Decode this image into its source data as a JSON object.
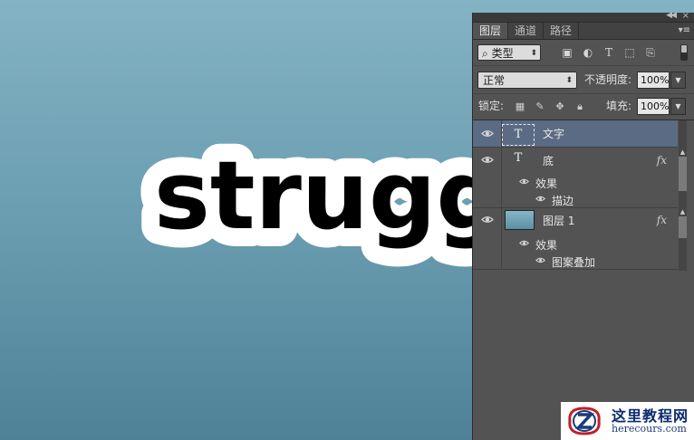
{
  "canvas": {
    "artwork_text": "struggl",
    "colors": {
      "bg_top": "#83b3c4",
      "bg_bottom": "#4f8197",
      "text": "#000000",
      "stroke": "#ffffff"
    }
  },
  "panel": {
    "tabs": [
      {
        "label": "图层",
        "active": true
      },
      {
        "label": "通道",
        "active": false
      },
      {
        "label": "路径",
        "active": false
      }
    ],
    "filter": {
      "kind_label": "类型",
      "icons": [
        "image-filter-icon",
        "adjustment-filter-icon",
        "type-filter-icon",
        "shape-filter-icon",
        "smart-object-filter-icon"
      ]
    },
    "blend": {
      "mode": "正常",
      "opacity_label": "不透明度:",
      "opacity_value": "100%"
    },
    "lock": {
      "label": "锁定:",
      "fill_label": "填充:",
      "fill_value": "100%"
    },
    "layers": [
      {
        "name": "文字",
        "type": "text",
        "selected": true,
        "visible": true
      },
      {
        "name": "底",
        "type": "text",
        "selected": false,
        "visible": true,
        "fx": "fx",
        "effects_label": "效果",
        "effects": [
          "描边"
        ]
      },
      {
        "name": "图层 1",
        "type": "image",
        "selected": false,
        "visible": true,
        "fx": "fx",
        "effects_label": "效果",
        "effects": [
          "图案叠加"
        ]
      }
    ]
  },
  "watermark": {
    "title": "这里教程网",
    "url": "herecours.com"
  }
}
